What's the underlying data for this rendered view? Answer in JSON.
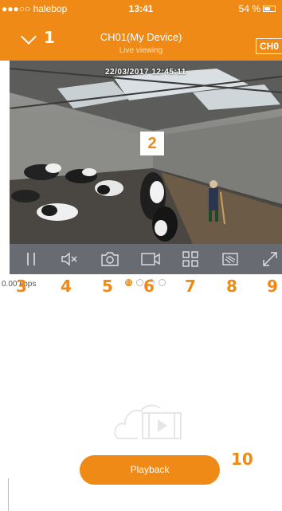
{
  "status_bar": {
    "carrier": "●●●○○ halebop",
    "time": "13:41",
    "battery": "54 %"
  },
  "header": {
    "title": "CH01(My Device)",
    "subtitle": "Live viewing",
    "channel_badge": "CH0"
  },
  "video": {
    "timestamp": "22/03/2017   12:45:11"
  },
  "controls": {
    "icons": [
      "pause-icon",
      "mute-icon",
      "snapshot-camera-icon",
      "record-video-icon",
      "grid-layout-icon",
      "image-quality-icon",
      "fullscreen-icon"
    ]
  },
  "stream": {
    "bitrate": "0.00 kbps",
    "page_badge": "01"
  },
  "playback": {
    "button_label": "Playback"
  },
  "callouts": [
    "1",
    "2",
    "3",
    "4",
    "5",
    "6",
    "7",
    "8",
    "9",
    "10"
  ],
  "colors": {
    "accent": "#f08a16",
    "control_bar": "#696b73"
  }
}
